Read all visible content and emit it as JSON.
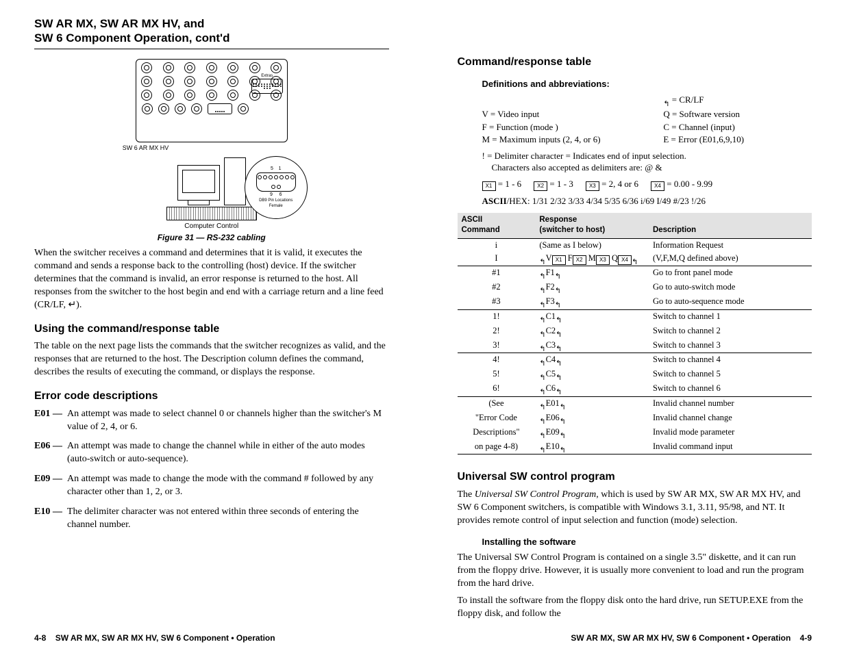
{
  "left": {
    "header": "SW AR MX, SW AR MX HV, and\nSW 6 Component Operation, cont'd",
    "device_label": "SW 6 AR MX HV",
    "zoom_pins_top": "5    1",
    "zoom_pins_bot": "9     6",
    "zoom_label_a": "DB9 Pin Locations",
    "zoom_label_b": "Female",
    "device_extras": "Extras",
    "computer_control": "Computer Control",
    "fig_caption": "Figure 31 — RS-232 cabling",
    "intro": "When the switcher receives a command and determines that it is valid, it executes the command and sends a response back to the controlling (host) device.  If the switcher determines that the command is invalid, an error response is returned to the host.  All responses from the switcher to the host begin and end with a carriage return and a line feed (CR/LF, ↵).",
    "h_using": "Using the command/response table",
    "p_using": "The table on the next page lists the commands that the switcher recognizes as valid, and the responses that are returned to the host.  The Description column defines the command, describes the results of executing the command, or displays the response.",
    "h_errs": "Error code descriptions",
    "errs": [
      {
        "code": "E01 —",
        "txt": "An attempt was made to select channel 0 or channels higher than the switcher's M value of 2, 4, or 6."
      },
      {
        "code": "E06 —",
        "txt": "An attempt was made to change the channel while in either of the auto modes (auto-switch or auto-sequence)."
      },
      {
        "code": "E09 —",
        "txt": "An attempt was made to change the mode with the command # followed by any character other than 1, 2, or 3."
      },
      {
        "code": "E10 —",
        "txt": "The delimiter character was not entered within three seconds of entering the channel number."
      }
    ],
    "footer_pg": "4-8",
    "footer_txt": "SW AR MX, SW AR MX HV, SW 6 Component • Operation"
  },
  "right": {
    "h_cmd": "Command/response table",
    "h_defs": "Definitions and abbreviations:",
    "crlf_line": " = CR/LF",
    "defs_rows": [
      {
        "a": "V = Video input",
        "b": "Q = Software version"
      },
      {
        "a": "F = Function (mode )",
        "b": "C = Channel (input)"
      },
      {
        "a": "M = Maximum inputs (2, 4, or 6)",
        "b": "E = Error (E01,6,9,10)"
      }
    ],
    "delim1": "! = Delimiter character = Indicates end of input selection.",
    "delim2": "Characters also accepted as delimiters are: @ &",
    "ranges": [
      {
        "sym": "X1",
        "txt": " = 1 - 6"
      },
      {
        "sym": "X2",
        "txt": " = 1 - 3"
      },
      {
        "sym": "X3",
        "txt": " = 2, 4 or 6"
      },
      {
        "sym": "X4",
        "txt": " = 0.00 - 9.99"
      }
    ],
    "ascii_hex_pre": "ASCII",
    "ascii_hex_rest": "/HEX:  1/31  2/32  3/33  4/34  5/35  6/36  i/69  I/49  #/23  !/26",
    "thead": {
      "c1a": "ASCII",
      "c1b": "Command",
      "c2a": "Response",
      "c2b": "(switcher to host)",
      "c3": "Description"
    },
    "rows": [
      {
        "sep": false,
        "c1": "i",
        "c2raw": {
          "type": "txt",
          "val": "(Same as I below)"
        },
        "c3": "Information Request"
      },
      {
        "sep": false,
        "c1": "I",
        "c2raw": {
          "type": "sym",
          "parts": [
            "↵V",
            "X1",
            " F",
            "X2",
            " M",
            "X3",
            " Q",
            "X4",
            "↵"
          ]
        },
        "c3": "(V,F,M,Q defined above)"
      },
      {
        "sep": true,
        "c1": "#1",
        "c2raw": {
          "type": "crlf",
          "val": "F1"
        },
        "c3": "Go to front panel mode"
      },
      {
        "sep": false,
        "c1": "#2",
        "c2raw": {
          "type": "crlf",
          "val": "F2"
        },
        "c3": "Go to auto-switch mode"
      },
      {
        "sep": false,
        "c1": "#3",
        "c2raw": {
          "type": "crlf",
          "val": "F3"
        },
        "c3": "Go to auto-sequence mode"
      },
      {
        "sep": true,
        "c1": "1!",
        "c2raw": {
          "type": "crlf",
          "val": "C1"
        },
        "c3": "Switch to channel 1"
      },
      {
        "sep": false,
        "c1": "2!",
        "c2raw": {
          "type": "crlf",
          "val": "C2"
        },
        "c3": "Switch to channel 2"
      },
      {
        "sep": false,
        "c1": "3!",
        "c2raw": {
          "type": "crlf",
          "val": "C3"
        },
        "c3": "Switch to channel 3"
      },
      {
        "sep": true,
        "c1": "4!",
        "c2raw": {
          "type": "crlf",
          "val": "C4"
        },
        "c3": "Switch to channel 4"
      },
      {
        "sep": false,
        "c1": "5!",
        "c2raw": {
          "type": "crlf",
          "val": "C5"
        },
        "c3": "Switch to channel 5"
      },
      {
        "sep": false,
        "c1": "6!",
        "c2raw": {
          "type": "crlf",
          "val": "C6"
        },
        "c3": "Switch to channel 6"
      },
      {
        "sep": true,
        "c1": "(See",
        "c2raw": {
          "type": "crlf",
          "val": "E01"
        },
        "c3": "Invalid channel number"
      },
      {
        "sep": false,
        "c1": "\"Error Code",
        "c2raw": {
          "type": "crlf",
          "val": "E06"
        },
        "c3": "Invalid channel change"
      },
      {
        "sep": false,
        "c1": "Descriptions\"",
        "c2raw": {
          "type": "crlf",
          "val": "E09"
        },
        "c3": "Invalid mode parameter"
      },
      {
        "sep": false,
        "c1": "on page 4-8)",
        "c2raw": {
          "type": "crlf",
          "val": "E10"
        },
        "c3": "Invalid command input"
      }
    ],
    "h_usw": "Universal SW control program",
    "p_usw_pre": "The ",
    "p_usw_em": "Universal SW Control Program",
    "p_usw_post": ", which is used by SW AR MX, SW AR MX HV, and SW 6 Component switchers, is compatible with Windows 3.1, 3.11, 95/98, and NT.  It provides remote control of input selection and function (mode) selection.",
    "h_install": "Installing the software",
    "p_install1": "The Universal SW Control Program is contained on a single 3.5\" diskette, and it can run from the floppy drive.  However, it is usually more convenient to load and run the program from the hard drive.",
    "p_install2": "To install the software from the floppy disk onto the hard drive, run SETUP.EXE from the floppy disk, and follow the",
    "footer_txt": "SW AR MX, SW AR MX HV, SW 6 Component • Operation",
    "footer_pg": "4-9"
  }
}
